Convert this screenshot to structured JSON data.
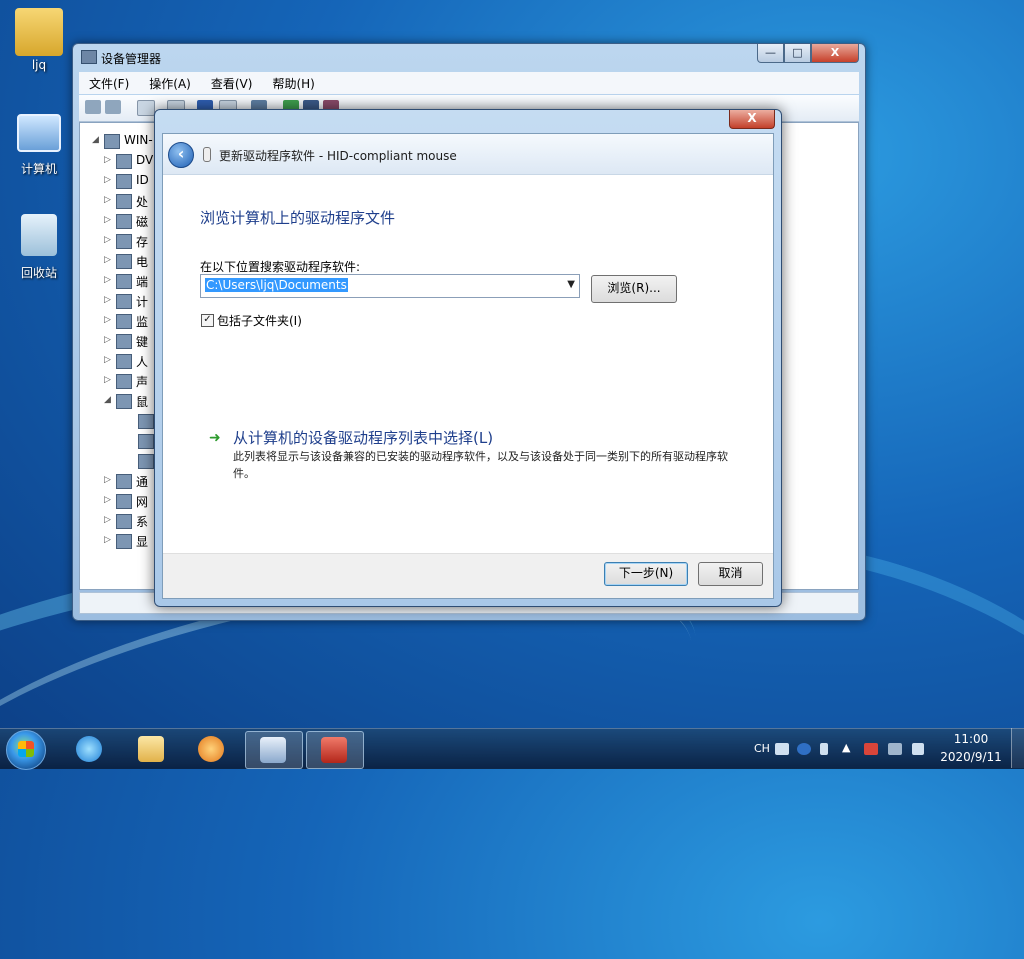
{
  "desktop": {
    "icons": [
      {
        "label": "ljq"
      },
      {
        "label": "计算机"
      },
      {
        "label": "回收站"
      }
    ]
  },
  "device_manager": {
    "title": "设备管理器",
    "window_buttons": {
      "minimize": "—",
      "maximize": "□",
      "close": "X"
    },
    "menu": [
      "文件(F)",
      "操作(A)",
      "查看(V)",
      "帮助(H)"
    ],
    "tree": {
      "root": "WIN-",
      "categories": [
        "DV",
        "ID",
        "处",
        "磁",
        "存",
        "电",
        "端",
        "计",
        "监",
        "键",
        "人",
        "声",
        "鼠",
        "",
        "",
        "",
        "通",
        "网",
        "系",
        "显"
      ]
    }
  },
  "wizard": {
    "close_label": "X",
    "header_title": "更新驱动程序软件 - HID-compliant mouse",
    "heading": "浏览计算机上的驱动程序文件",
    "location_label": "在以下位置搜索驱动程序软件:",
    "path_value": "C:\\Users\\ljq\\Documents",
    "browse_button": "浏览(R)...",
    "include_subfolders": {
      "label": "包括子文件夹(I)",
      "checked": true
    },
    "pick_link": "从计算机的设备驱动程序列表中选择(L)",
    "pick_description": "此列表将显示与该设备兼容的已安装的驱动程序软件，以及与该设备处于同一类别下的所有驱动程序软件。",
    "next_button": "下一步(N)",
    "cancel_button": "取消"
  },
  "taskbar": {
    "tray_lang": "CH",
    "time": "11:00",
    "date": "2020/9/11"
  }
}
